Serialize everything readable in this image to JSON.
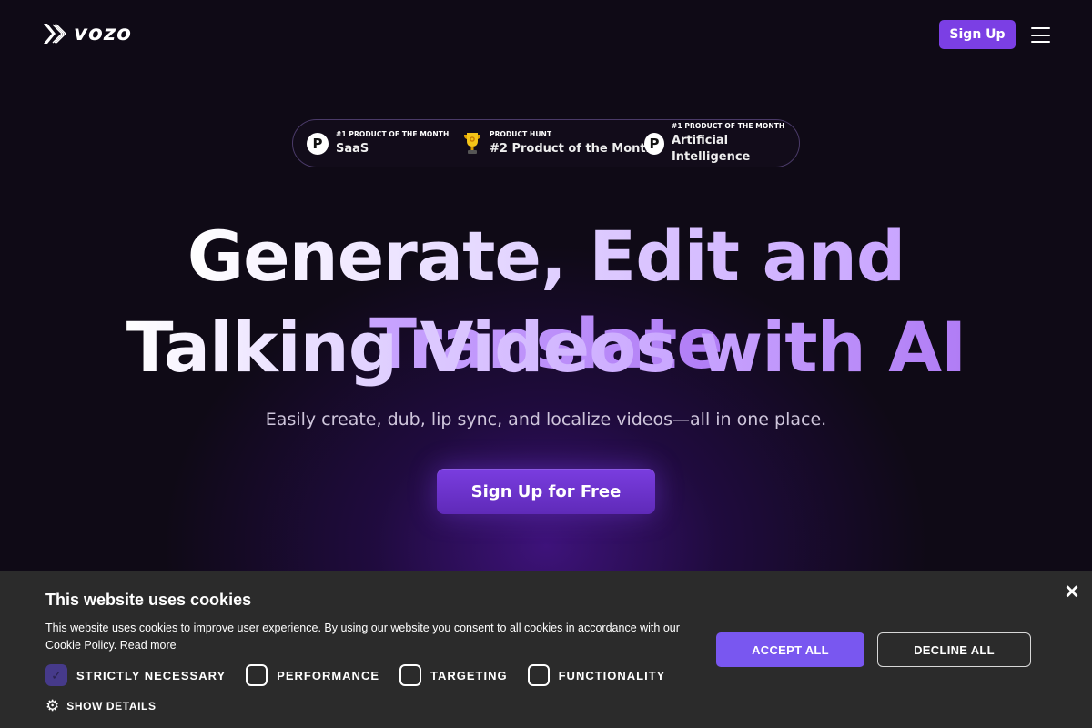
{
  "header": {
    "logo_text": "vozo",
    "signup_label": "Sign Up",
    "menu_icon": "hamburger-menu-icon"
  },
  "awards": [
    {
      "icon": "product-hunt-icon",
      "icon_glyph": "P",
      "small": "#1 PRODUCT OF THE MONTH",
      "big": "SaaS"
    },
    {
      "icon": "trophy-icon",
      "small": "PRODUCT HUNT",
      "big": "#2 Product of the Month"
    },
    {
      "icon": "product-hunt-icon",
      "icon_glyph": "P",
      "small": "#1 PRODUCT OF THE MONTH",
      "big": "Artificial Intelligence"
    }
  ],
  "hero": {
    "headline_line1": "Generate, Edit and Translate",
    "headline_line2": "Talking Videos with AI",
    "subtitle": "Easily create, dub, lip sync, and localize videos—all in one place.",
    "cta_label": "Sign Up for Free"
  },
  "cookie_banner": {
    "title": "This website uses cookies",
    "body": "This website uses cookies to improve user experience. By using our website you consent to all cookies in accordance with our Cookie Policy.",
    "read_more": "Read more",
    "options": [
      {
        "label": "STRICTLY NECESSARY",
        "checked": true
      },
      {
        "label": "PERFORMANCE",
        "checked": false
      },
      {
        "label": "TARGETING",
        "checked": false
      },
      {
        "label": "FUNCTIONALITY",
        "checked": false
      }
    ],
    "show_details": "SHOW DETAILS",
    "accept_label": "ACCEPT ALL",
    "decline_label": "DECLINE ALL",
    "close_glyph": "✕"
  },
  "colors": {
    "background": "#0f0a16",
    "brand_purple": "#7b3fe4",
    "accept_purple": "#7957f0",
    "cookie_bg": "#2b2b2b"
  }
}
